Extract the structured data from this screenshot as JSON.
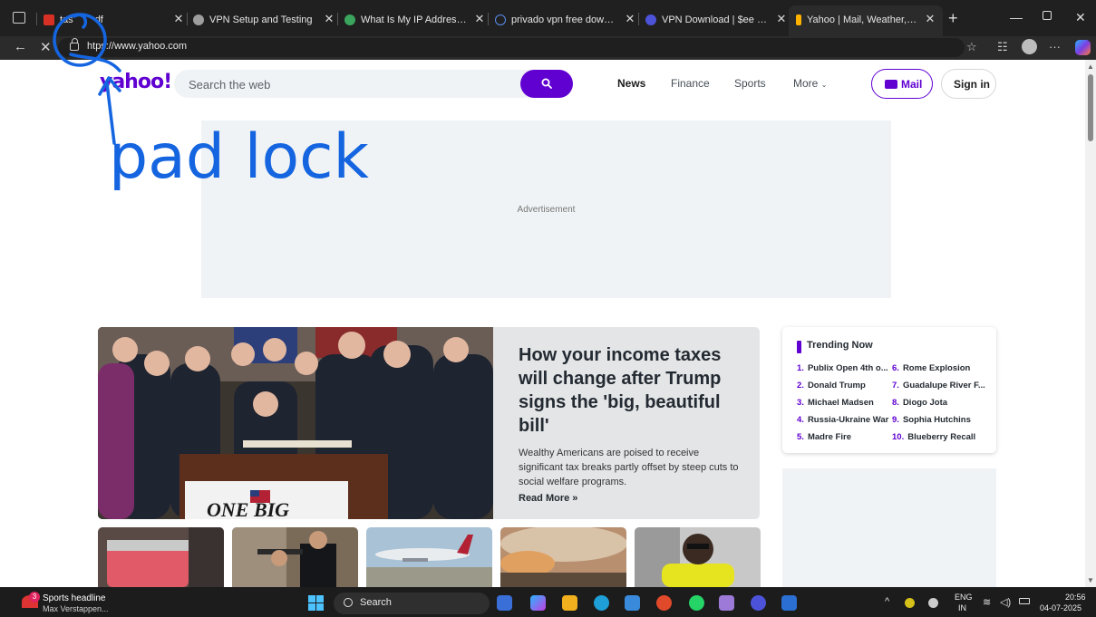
{
  "browser": {
    "tabs": [
      {
        "title": "tas",
        "title2": "df",
        "favicon_color": "#d93025"
      },
      {
        "title": "VPN Setup and Testing",
        "favicon_color": "#9e9e9e"
      },
      {
        "title": "What Is My IP Address - See",
        "favicon_color": "#3ba55d"
      },
      {
        "title": "privado vpn free download",
        "favicon_color": "#5a8dee"
      },
      {
        "title": "VPN Download | $ee VPN De",
        "favicon_color": "#4c53d9"
      },
      {
        "title": "Yahoo | Mail, Weather, Searc",
        "favicon_color": "#ffb300"
      }
    ],
    "url_prefix": "ht",
    "url_rest": "ps://www.yahoo.com"
  },
  "annotation": {
    "text": "pad lock",
    "color": "#1565e0"
  },
  "yahoo": {
    "logo": "yahoo!",
    "search_placeholder": "Search the web",
    "nav": {
      "news": "News",
      "finance": "Finance",
      "sports": "Sports",
      "more": "More"
    },
    "mail": "Mail",
    "signin": "Sign in",
    "ad_label": "Advertisement",
    "hero": {
      "title": "How your income taxes will change after Trump signs the 'big, beautiful bill'",
      "desc": "Wealthy Americans are poised to receive significant tax breaks partly offset by steep cuts to social welfare programs.",
      "more": "Read More »",
      "sign_text": "ONE BIG"
    },
    "trending": {
      "title": "Trending Now",
      "left": [
        {
          "n": "1.",
          "t": "Publix Open 4th o..."
        },
        {
          "n": "2.",
          "t": "Donald Trump"
        },
        {
          "n": "3.",
          "t": "Michael Madsen"
        },
        {
          "n": "4.",
          "t": "Russia-Ukraine War"
        },
        {
          "n": "5.",
          "t": "Madre Fire"
        }
      ],
      "right": [
        {
          "n": "6.",
          "t": "Rome Explosion"
        },
        {
          "n": "7.",
          "t": "Guadalupe River F..."
        },
        {
          "n": "8.",
          "t": "Diogo Jota"
        },
        {
          "n": "9.",
          "t": "Sophia Hutchins"
        },
        {
          "n": "10.",
          "t": "Blueberry Recall"
        }
      ]
    }
  },
  "taskbar": {
    "news_title": "Sports headline",
    "news_sub": "Max Verstappen...",
    "badge": "3",
    "search": "Search",
    "lang1": "ENG",
    "lang2": "IN",
    "time": "20:56",
    "date": "04-07-2025"
  }
}
